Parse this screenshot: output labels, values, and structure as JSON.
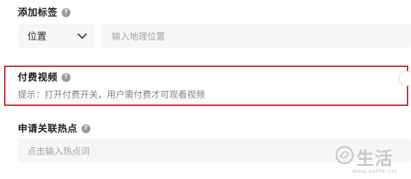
{
  "tags_section": {
    "title": "添加标签",
    "help_icon": "question-circle-icon",
    "location_select": {
      "selected": "位置",
      "icon": "chevron-down-icon"
    },
    "location_input": {
      "placeholder": "输入地理位置"
    }
  },
  "paid_section": {
    "title": "付费视频",
    "help_icon": "question-circle-icon",
    "hint": "提示：打开付费开关，用户需付费才可观看视频",
    "highlight_color": "#c0282c"
  },
  "hotspot_section": {
    "title": "申请关联热点",
    "help_icon": "question-circle-icon",
    "input": {
      "placeholder": "点击输入热点词"
    }
  },
  "watermark": {
    "text": "生活",
    "url": "www.aelife.net"
  }
}
